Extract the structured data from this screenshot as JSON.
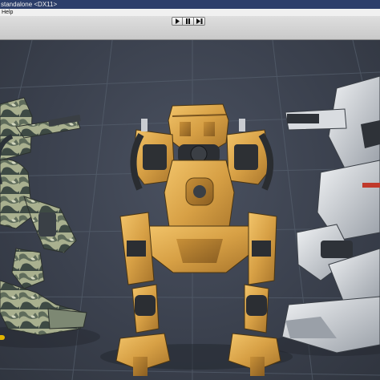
{
  "window": {
    "title": "standalone <DX11>"
  },
  "menubar": {
    "items": [
      "Help"
    ]
  },
  "toolbar": {
    "play_icon": "play-icon",
    "pause_icon": "pause-icon",
    "step_icon": "step-icon"
  },
  "viewport": {
    "description_colors": {
      "mech_center": "#d8a548",
      "mech_left_camo": "#9aa58a",
      "mech_right": "#d0d3d8",
      "accent_red": "#c0392b"
    }
  }
}
